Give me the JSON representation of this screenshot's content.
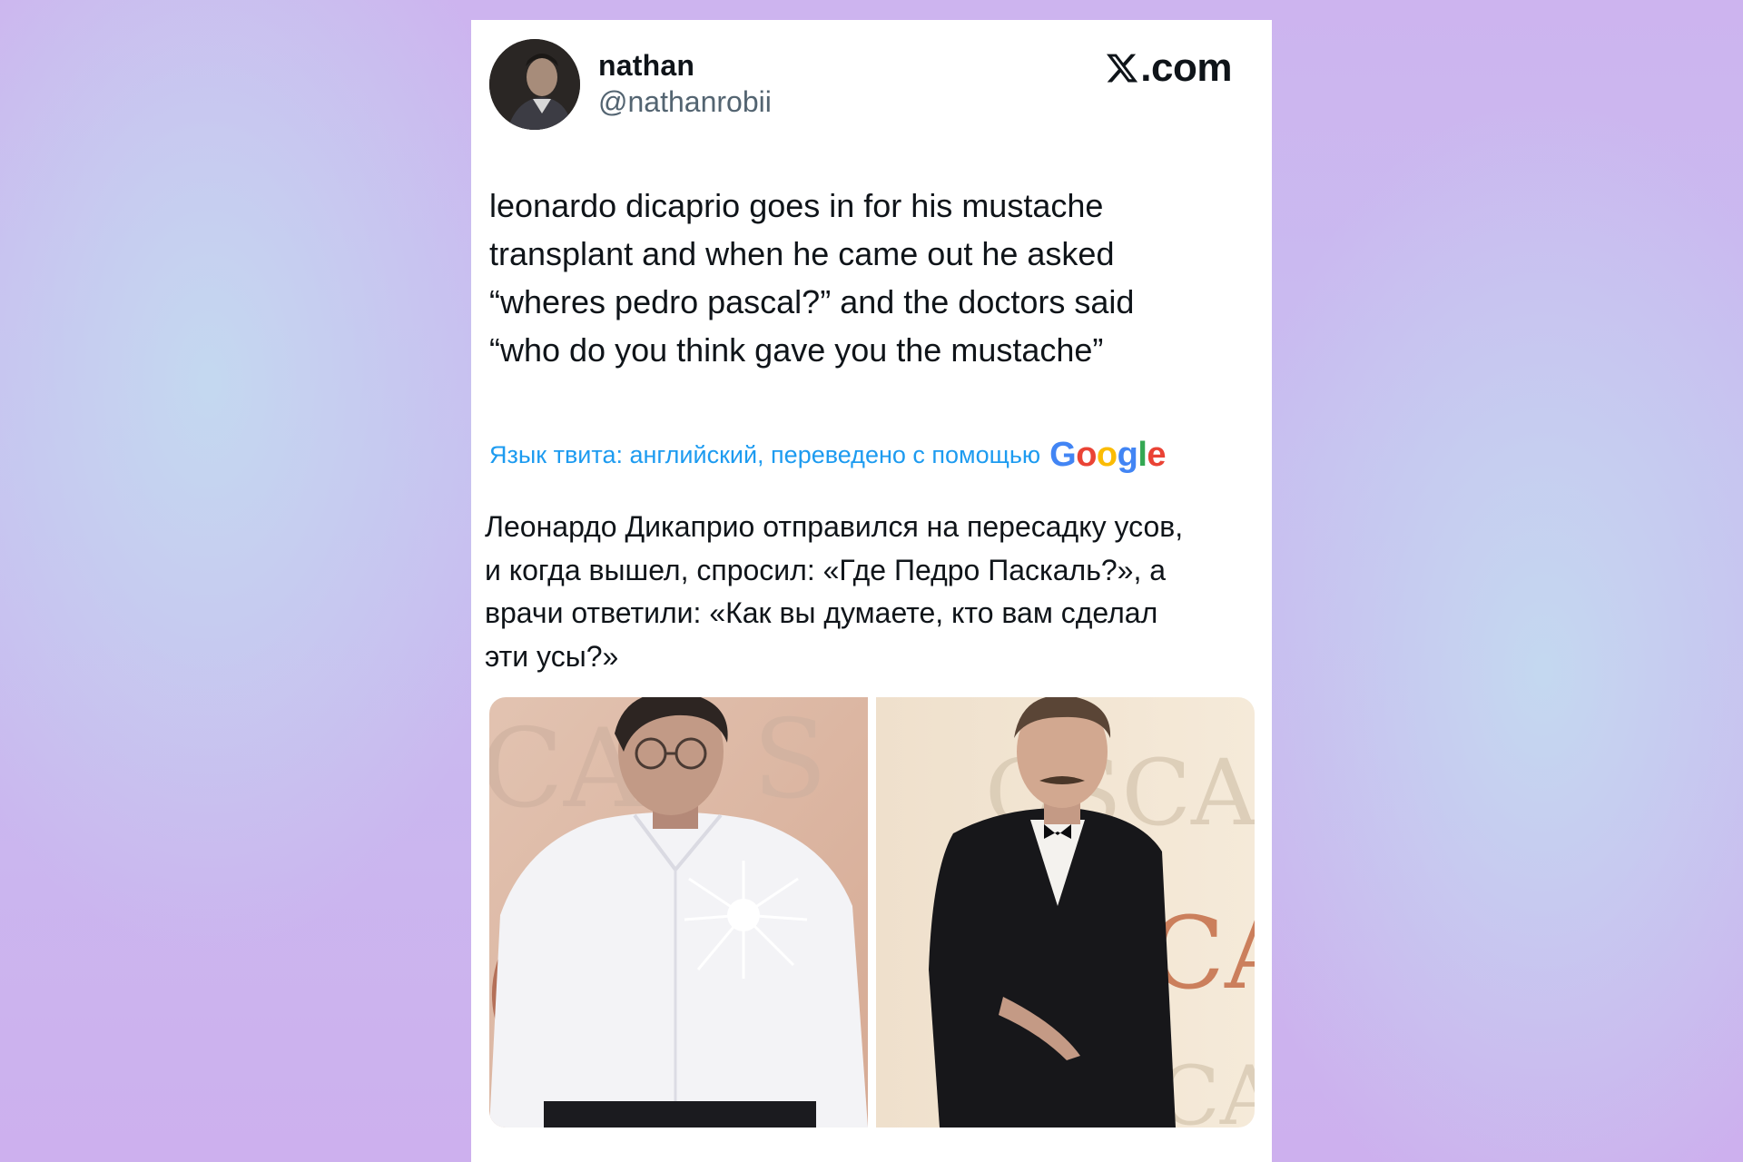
{
  "tweet": {
    "display_name": "nathan",
    "handle": "@nathanrobii",
    "brand": ".com",
    "brand_icon": "x-logo-icon",
    "text": "leonardo dicaprio goes in for his mustache\ntransplant and when he came out he asked\n“wheres pedro pascal?” and the doctors said\n“who do you think gave you the mustache”",
    "translation_note": "Язык твита: английский, переведено с помощью",
    "translation_provider": "Google",
    "translated_text": "Леонардо Дикаприо отправился на пересадку усов,\nи когда вышел, спросил: «Где Педро Паскаль?», а\nврачи ответили: «Как вы думаете, кто вам сделал\nэти усы?»",
    "media": [
      {
        "icon": "photo-white-shirt"
      },
      {
        "icon": "photo-black-tuxedo"
      }
    ]
  },
  "colors": {
    "text": "#0f1419",
    "secondary": "#536471",
    "link": "#1d9bf0",
    "google_blue": "#4285F4",
    "google_red": "#EA4335",
    "google_yellow": "#FBBC05",
    "google_green": "#34A853"
  }
}
